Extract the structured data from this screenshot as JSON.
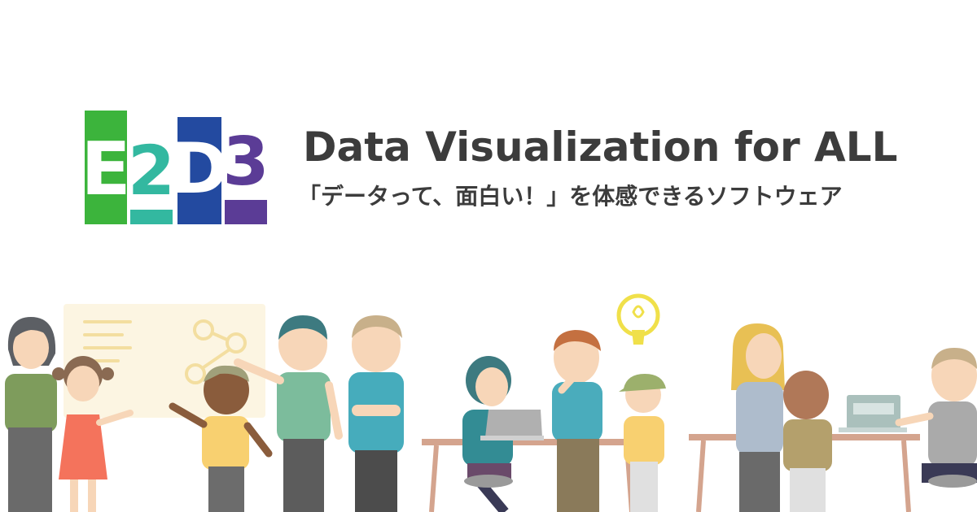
{
  "logo": {
    "letters": [
      "E",
      "2",
      "D",
      "3"
    ],
    "colors": [
      "#3cb43c",
      "#33b8a0",
      "#234aa0",
      "#5b3c96"
    ]
  },
  "headline": "Data Visualization for ALL",
  "tagline": "「データって、面白い！」を体感できるソフトウェア",
  "illustration": {
    "icons": [
      "whiteboard-icon",
      "lightbulb-icon",
      "laptop-icon"
    ]
  }
}
